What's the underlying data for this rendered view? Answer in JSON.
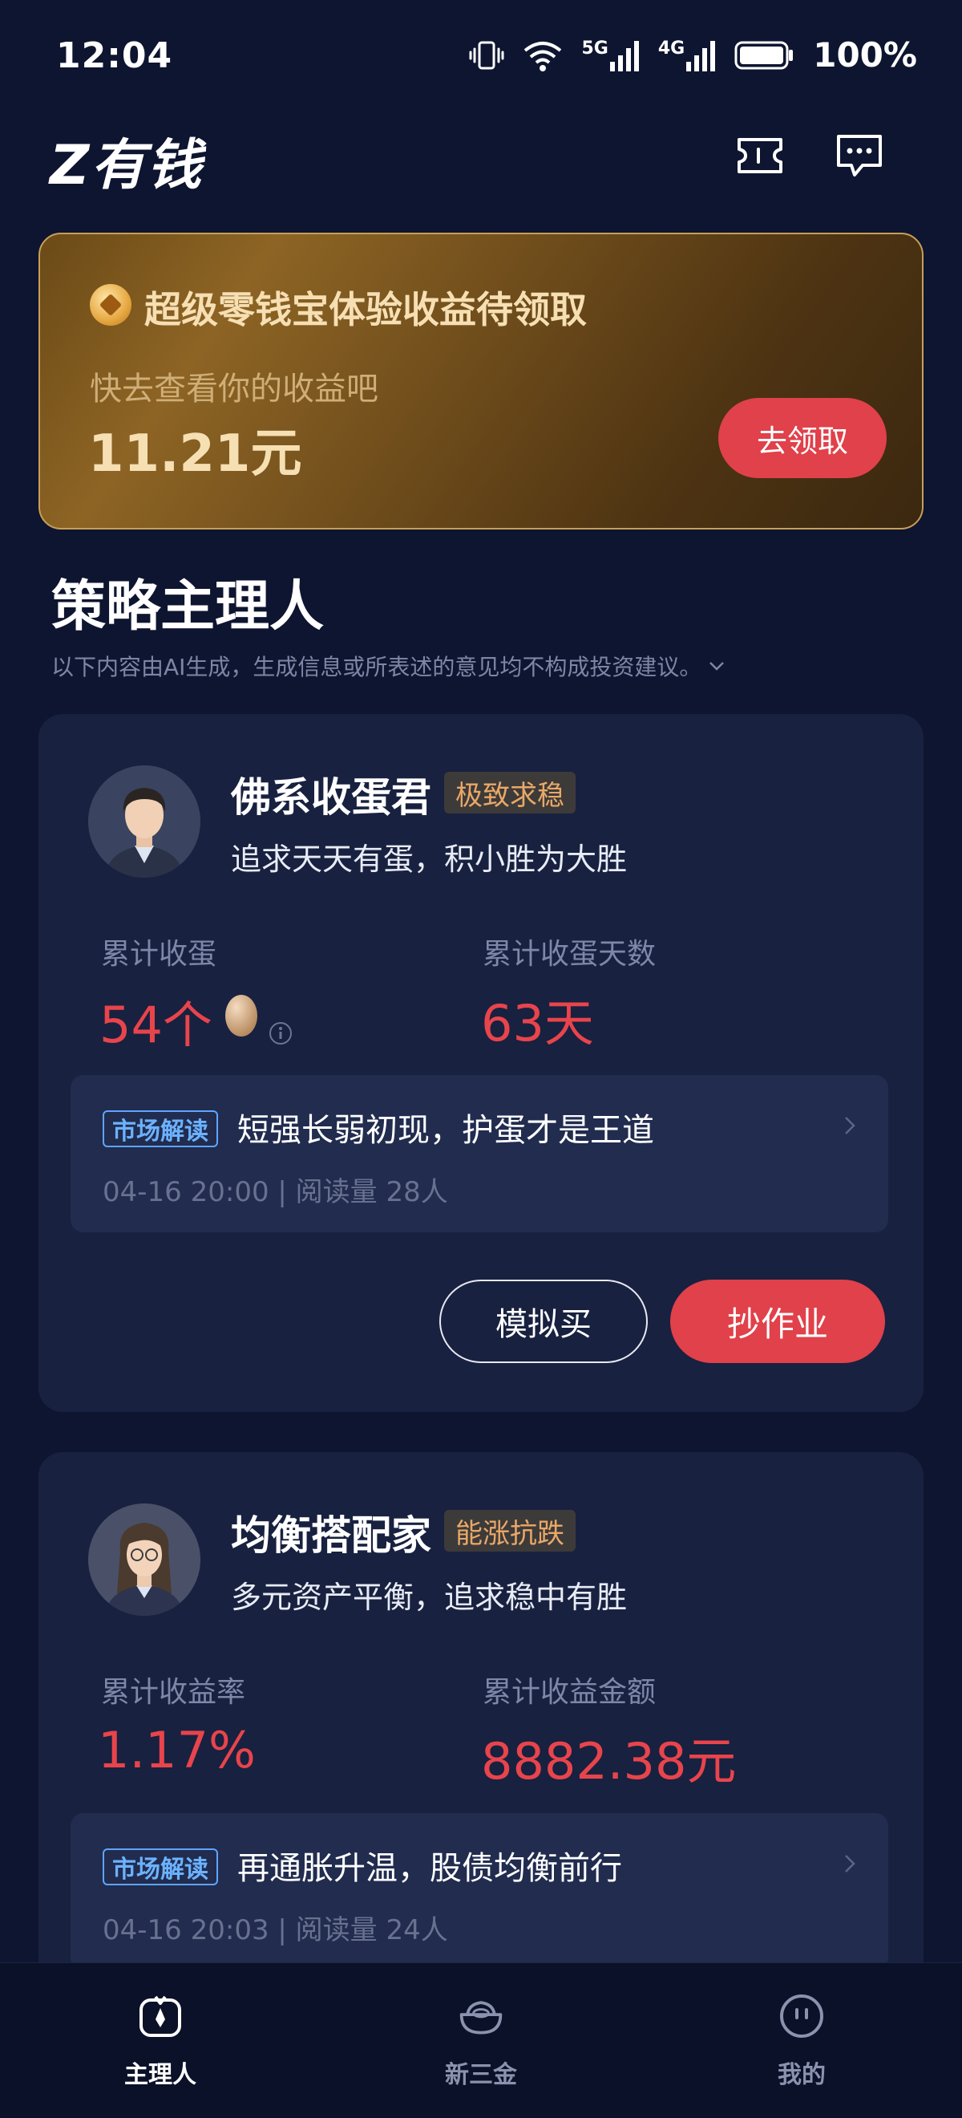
{
  "status_bar": {
    "time": "12:04",
    "network_1": "5G",
    "network_2": "4G",
    "battery": "100%"
  },
  "header": {
    "logo": "Z有钱",
    "icons": [
      "ticket-icon",
      "message-icon"
    ]
  },
  "promo": {
    "title": "超级零钱宝体验收益待领取",
    "subtitle": "快去查看你的收益吧",
    "amount": "11.21元",
    "button": "去领取",
    "accent": "#e0414a"
  },
  "section": {
    "title": "策略主理人",
    "disclaimer": "以下内容由AI生成，生成信息或所表述的意见均不构成投资建议。"
  },
  "managers": [
    {
      "name": "佛系收蛋君",
      "tag": "极致求稳",
      "desc": "追求天天有蛋，积小胜为大胜",
      "stat1_label": "累计收蛋",
      "stat1_value": "54个",
      "stat2_label": "累计收蛋天数",
      "stat2_value": "63天",
      "news_badge": "市场解读",
      "news_headline": "短强长弱初现，护蛋才是王道",
      "news_meta": "04-16 20:00 | 阅读量 28人",
      "btn_sim": "模拟买",
      "btn_copy": "抄作业"
    },
    {
      "name": "均衡搭配家",
      "tag": "能涨抗跌",
      "desc": "多元资产平衡，追求稳中有胜",
      "stat1_label": "累计收益率",
      "stat1_value": "1.17%",
      "stat2_label": "累计收益金额",
      "stat2_value": "8882.38元",
      "news_badge": "市场解读",
      "news_headline": "再通胀升温，股债均衡前行",
      "news_meta": "04-16 20:03 | 阅读量 24人"
    }
  ],
  "bottom_nav": [
    {
      "label": "主理人",
      "icon": "manager-icon",
      "active": true
    },
    {
      "label": "新三金",
      "icon": "ingot-icon",
      "active": false
    },
    {
      "label": "我的",
      "icon": "profile-face-icon",
      "active": false
    }
  ],
  "colors": {
    "background": "#0e1530",
    "card": "#18213f",
    "red": "#e8444c",
    "gold": "#c79f58"
  }
}
